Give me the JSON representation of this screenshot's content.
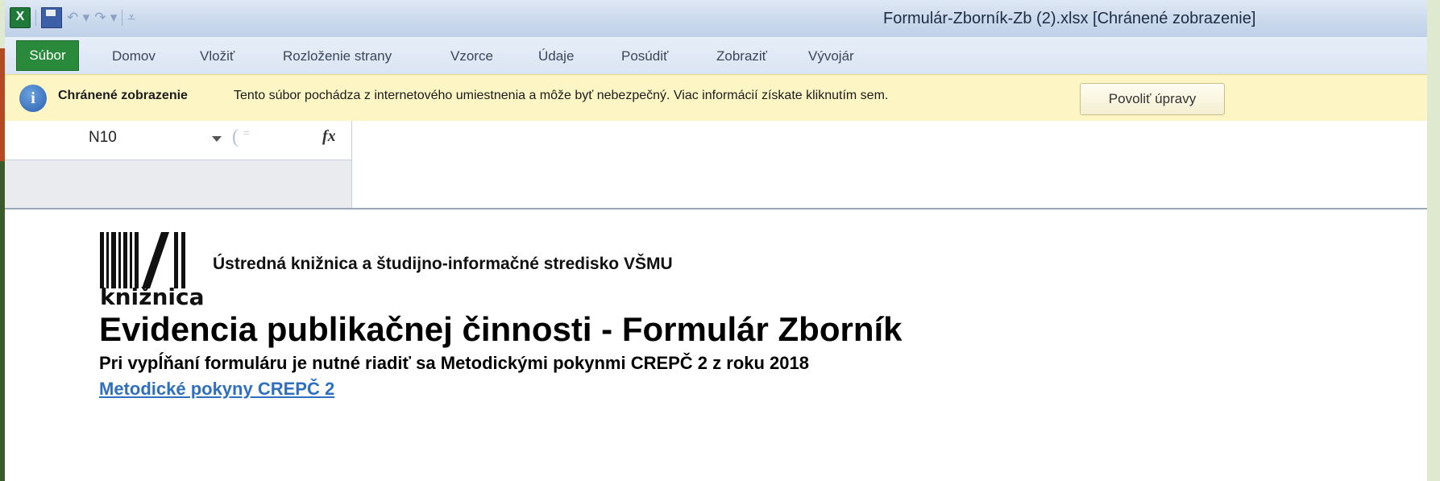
{
  "window": {
    "title": "Formulár-Zborník-Zb (2).xlsx  [Chránené zobrazenie]"
  },
  "quick_access": {
    "app_icon_letter": "X",
    "icons": [
      "excel-icon",
      "save-icon",
      "undo-icon",
      "redo-icon",
      "customize-icon"
    ]
  },
  "ribbon": {
    "file_tab": "Súbor",
    "tabs": [
      "Domov",
      "Vložiť",
      "Rozloženie strany",
      "Vzorce",
      "Údaje",
      "Posúdiť",
      "Zobraziť",
      "Vývojár"
    ]
  },
  "protected_view": {
    "title": "Chránené zobrazenie",
    "message": "Tento súbor pochádza z internetového umiestnenia a môže byť nebezpečný. Viac informácií získate kliknutím sem.",
    "button": "Povoliť úpravy"
  },
  "formula_bar": {
    "name_box": "N10",
    "fx_symbol": "fx",
    "formula": ""
  },
  "sheet": {
    "logo_text": "knižnica",
    "organization": "Ústredná knižnica a študijno-informačné stredisko VŠMU",
    "title": "Evidencia publikačnej činnosti - Formulár Zborník",
    "subtitle": "Pri vypĺňaní formuláru je nutné riadiť sa Metodickými pokynmi CREPČ 2 z roku 2018",
    "link": "Metodické pokyny CREPČ 2"
  },
  "colors": {
    "file_tab": "#2a8a3c",
    "protected_bar": "#fdf6c4",
    "link": "#2f6fbf"
  }
}
